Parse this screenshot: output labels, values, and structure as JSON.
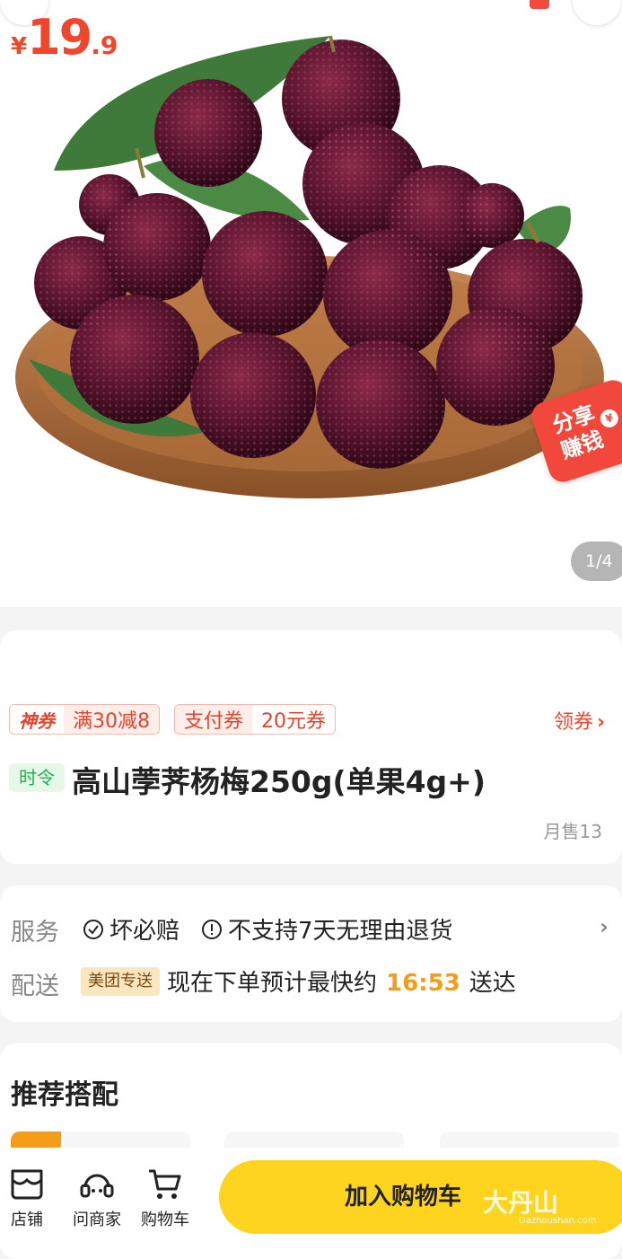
{
  "hero": {
    "pager": "1/4",
    "share_line1": "分享",
    "share_line2": "赚钱"
  },
  "price": {
    "currency": "¥",
    "integer": "19",
    "decimal": ".9"
  },
  "promos": [
    {
      "label": "神券",
      "value": "满30减8"
    },
    {
      "label": "支付券",
      "value": "20元券"
    }
  ],
  "coupon_link": "领券",
  "product": {
    "tag": "时令",
    "title": "高山荸荠杨梅250g(单果4g+)",
    "sold": "月售13"
  },
  "service": {
    "label": "服务",
    "items": [
      "坏必赔",
      "不支持7天无理由退货"
    ]
  },
  "delivery": {
    "label": "配送",
    "badge": "美团专送",
    "text_before": "现在下单预计最快约",
    "time": "16:53",
    "text_after": "送达"
  },
  "recommend": {
    "title": "推荐搭配"
  },
  "bottom_bar": {
    "store": "店铺",
    "ask_merchant": "问商家",
    "cart": "购物车",
    "add_to_cart": "加入购物车"
  },
  "watermark": {
    "main": "大丹山",
    "sub": "Dazhoushan.com"
  },
  "colors": {
    "price_red": "#f0472c",
    "accent_yellow": "#fed41f",
    "time_orange": "#f59d1b",
    "fresh_green": "#18b24f"
  }
}
